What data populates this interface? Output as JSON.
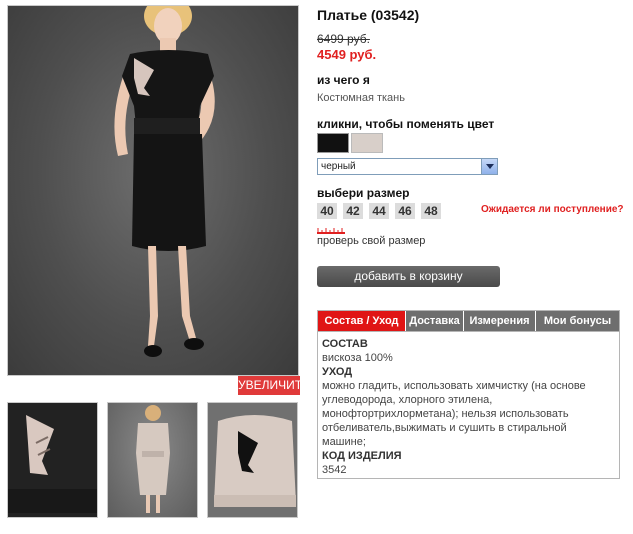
{
  "product": {
    "title": "Платье (03542)",
    "old_price": "6499 руб.",
    "new_price": "4549 руб."
  },
  "material": {
    "label": "из чего я",
    "value": "Костюмная ткань"
  },
  "color": {
    "label": "кликни, чтобы поменять цвет",
    "swatches": [
      "#111111",
      "#d8cfc9"
    ],
    "selected": "черный"
  },
  "size": {
    "label": "выбери размер",
    "options": [
      "40",
      "42",
      "44",
      "46",
      "48"
    ],
    "await_link": "Ожидается ли поступление?",
    "check_link": "проверь свой размер"
  },
  "cart": {
    "button": "добавить в корзину"
  },
  "gallery": {
    "zoom_label": "УВЕЛИЧИТЬ"
  },
  "tabs": {
    "items": [
      "Состав / Уход",
      "Доставка",
      "Измерения",
      "Мои бонусы"
    ],
    "active": "Состав / Уход",
    "composition": {
      "heading": "СОСТАВ",
      "text": "вискоза 100%"
    },
    "care": {
      "heading": "УХОД",
      "lines": [
        "можно гладить, использовать химчистку (на основе",
        "углеводорода, хлорного этилена,",
        "монофтортрихлорметана); нельзя использовать",
        "отбеливатель,выжимать и сушить в стиральной",
        "машине;"
      ]
    },
    "code": {
      "heading": "КОД ИЗДЕЛИЯ",
      "text": "3542"
    }
  },
  "colors": {
    "accent": "#e02020",
    "tab_active": "#e01515",
    "tab_inactive": "#6e6e6e",
    "button": "#555555"
  }
}
